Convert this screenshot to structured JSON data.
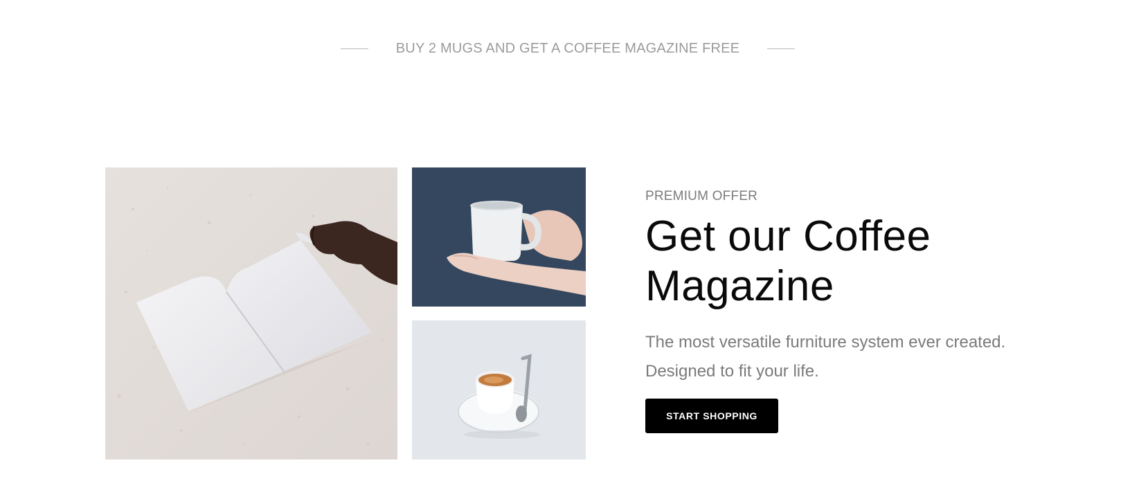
{
  "promo": {
    "text": "BUY 2 MUGS AND GET A COFFEE MAGAZINE FREE"
  },
  "gallery": {
    "images": [
      {
        "name": "magazine-photo",
        "subject": "open blank magazine held by hand on concrete"
      },
      {
        "name": "mug-photo",
        "subject": "hands holding white mug on navy background"
      },
      {
        "name": "espresso-photo",
        "subject": "espresso cup with spoon on saucer"
      }
    ]
  },
  "offer": {
    "eyebrow": "PREMIUM OFFER",
    "headline_line1": "Get our Coffee",
    "headline_line2": "Magazine",
    "body_line1": "The most versatile furniture system ever created.",
    "body_line2": "Designed to fit your life.",
    "cta_label": "START SHOPPING"
  },
  "colors": {
    "button_bg": "#000000",
    "button_text": "#ffffff",
    "muted_text": "#7a7a7a",
    "promo_text": "#9b9b9b",
    "mug_backdrop": "#34475e"
  }
}
